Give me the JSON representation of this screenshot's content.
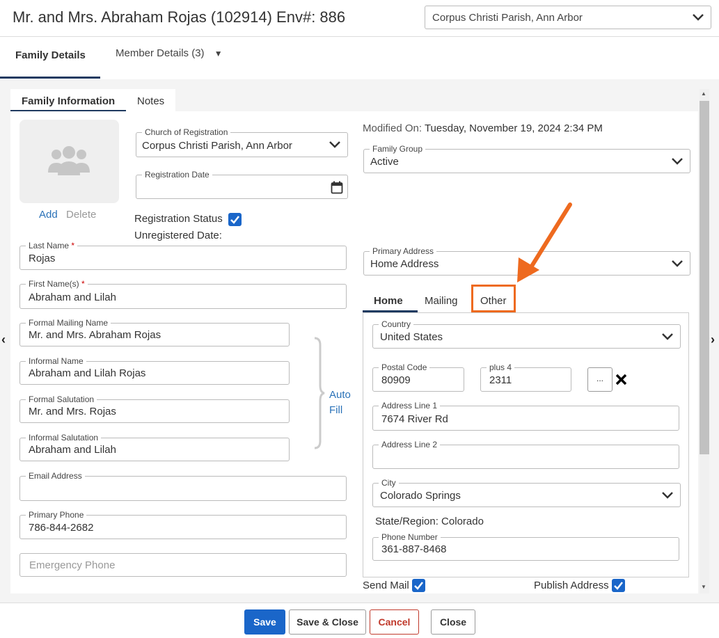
{
  "header": {
    "title": "Mr. and Mrs. Abraham Rojas (102914) Env#: 886",
    "parish_select": "Corpus Christi Parish, Ann Arbor"
  },
  "tabs": {
    "family_details": "Family Details",
    "member_details": "Member Details (3)"
  },
  "subtabs": {
    "family_information": "Family Information",
    "notes": "Notes"
  },
  "photo": {
    "add": "Add",
    "delete": "Delete"
  },
  "church_registration": {
    "label": "Church of Registration",
    "value": "Corpus Christi Parish, Ann Arbor"
  },
  "registration_date": {
    "label": "Registration Date",
    "value": ""
  },
  "registration_status": {
    "label": "Registration Status",
    "checked": true
  },
  "unregistered_date": "Unregistered Date:",
  "modified_on": {
    "label": "Modified On:",
    "value": "Tuesday, November 19, 2024 2:34 PM"
  },
  "family_group": {
    "label": "Family Group",
    "value": "Active"
  },
  "last_name": {
    "label": "Last Name",
    "required": "*",
    "value": "Rojas"
  },
  "first_names": {
    "label": "First Name(s)",
    "required": "*",
    "value": "Abraham and Lilah"
  },
  "formal_mailing_name": {
    "label": "Formal Mailing Name",
    "value": "Mr. and Mrs. Abraham Rojas"
  },
  "informal_name": {
    "label": "Informal Name",
    "value": "Abraham and Lilah Rojas"
  },
  "formal_salutation": {
    "label": "Formal Salutation",
    "value": "Mr. and Mrs. Rojas"
  },
  "informal_salutation": {
    "label": "Informal Salutation",
    "value": "Abraham and Lilah"
  },
  "auto_fill": {
    "line1": "Auto",
    "line2": "Fill"
  },
  "email": {
    "label": "Email Address",
    "value": ""
  },
  "primary_phone": {
    "label": "Primary Phone",
    "value": "786-844-2682"
  },
  "emergency_phone": {
    "placeholder": "Emergency Phone"
  },
  "primary_address": {
    "label": "Primary Address",
    "value": "Home Address"
  },
  "address_tabs": {
    "home": "Home",
    "mailing": "Mailing",
    "other": "Other"
  },
  "address": {
    "country_label": "Country",
    "country": "United States",
    "postal_label": "Postal Code",
    "postal": "80909",
    "plus4_label": "plus 4",
    "plus4": "2311",
    "ellipsis": "...",
    "line1_label": "Address Line 1",
    "line1": "7674 River Rd",
    "line2_label": "Address Line 2",
    "line2": "",
    "city_label": "City",
    "city": "Colorado Springs",
    "state_region": "State/Region: Colorado",
    "phone_label": "Phone Number",
    "phone": "361-887-8468"
  },
  "send_mail": {
    "label": "Send Mail",
    "checked": true
  },
  "publish_address": {
    "label": "Publish Address",
    "checked": true
  },
  "footer": {
    "save": "Save",
    "save_close": "Save & Close",
    "cancel": "Cancel",
    "close": "Close"
  },
  "colors": {
    "primary": "#1a66c9",
    "highlight": "#ee6a1f",
    "cancel": "#c0392b"
  }
}
